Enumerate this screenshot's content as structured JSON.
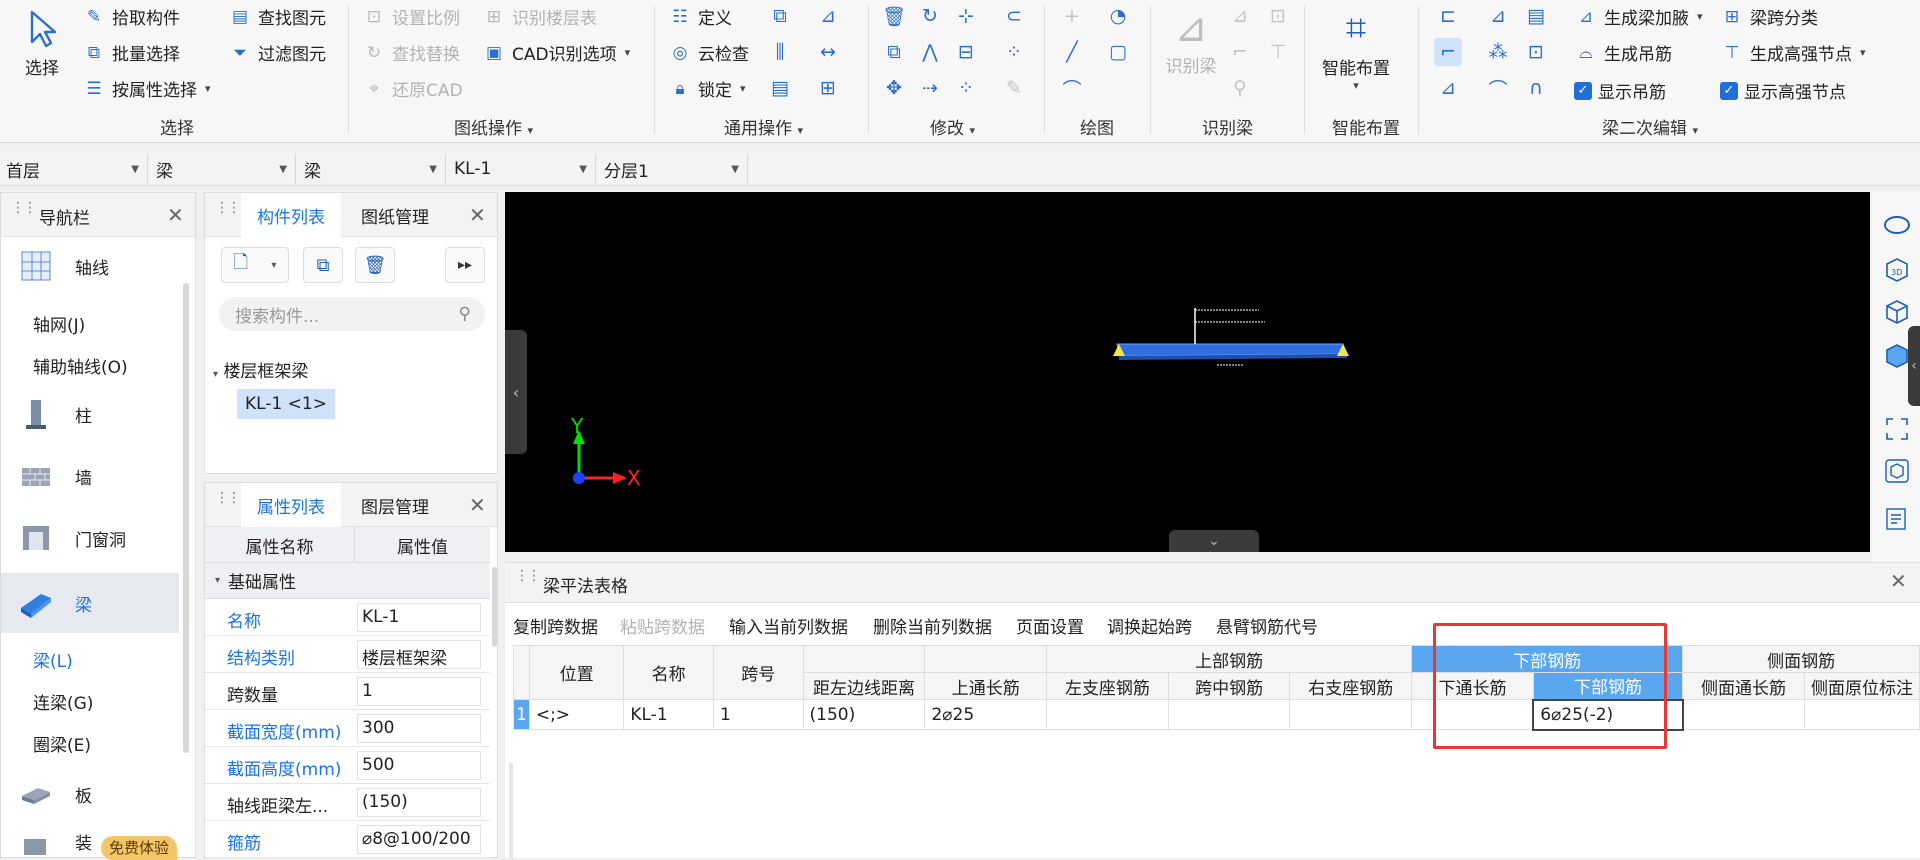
{
  "ribbon": {
    "select_group": {
      "select": "选择",
      "pick": "拾取构件",
      "batch": "批量选择",
      "by_attr": "按属性选择",
      "find": "查找图元",
      "filter": "过滤图元",
      "label": "选择"
    },
    "drawing_ops": {
      "set_scale": "设置比例",
      "identify_floor_table": "识别楼层表",
      "find_replace": "查找替换",
      "cad_options": "CAD识别选项",
      "restore_cad": "还原CAD",
      "label": "图纸操作"
    },
    "general_ops": {
      "define": "定义",
      "cloud_check": "云检查",
      "lock": "锁定",
      "label": "通用操作"
    },
    "modify": {
      "label": "修改"
    },
    "draw": {
      "label": "绘图"
    },
    "identify_beam": {
      "identify": "识别梁",
      "label": "识别梁"
    },
    "smart_layout": {
      "layout": "智能布置",
      "label": "智能布置"
    },
    "beam_secondary": {
      "gen_haunch": "生成梁加腋",
      "span_classify": "梁跨分类",
      "gen_hanger": "生成吊筋",
      "gen_high_node": "生成高强节点",
      "show_hanger": "显示吊筋",
      "show_high_node": "显示高强节点",
      "label": "梁二次编辑"
    }
  },
  "filterbar": [
    "首层",
    "梁",
    "梁",
    "KL-1",
    "分层1"
  ],
  "nav": {
    "title": "导航栏",
    "axis": "轴线",
    "axis_grid": "轴网(J)",
    "aux_axis": "辅助轴线(O)",
    "column": "柱",
    "wall": "墙",
    "door_window": "门窗洞",
    "beam": "梁",
    "beam_l": "梁(L)",
    "coupling_beam": "连梁(G)",
    "ring_beam": "圈梁(E)",
    "slab": "板",
    "free_trial": "免费体验",
    "partial_item": "装"
  },
  "component_list": {
    "tab1": "构件列表",
    "tab2": "图纸管理",
    "search_placeholder": "搜索构件...",
    "tree_parent": "楼层框架梁",
    "tree_child": "KL-1 <1>"
  },
  "properties": {
    "tab1": "属性列表",
    "tab2": "图层管理",
    "col_name": "属性名称",
    "col_value": "属性值",
    "section": "基础属性",
    "rows": [
      {
        "k": "名称",
        "v": "KL-1",
        "blue": true
      },
      {
        "k": "结构类别",
        "v": "楼层框架梁",
        "blue": true
      },
      {
        "k": "跨数量",
        "v": "1",
        "blue": false
      },
      {
        "k": "截面宽度(mm)",
        "v": "300",
        "blue": true
      },
      {
        "k": "截面高度(mm)",
        "v": "500",
        "blue": true
      },
      {
        "k": "轴线距梁左...",
        "v": "(150)",
        "blue": false
      },
      {
        "k": "箍筋",
        "v": "⌀8@100/200",
        "blue": true
      }
    ]
  },
  "viewport": {
    "axis_y": "Y",
    "axis_x": "X"
  },
  "table_panel": {
    "title": "梁平法表格",
    "toolbar": [
      "复制跨数据",
      "粘贴跨数据",
      "输入当前列数据",
      "删除当前列数据",
      "页面设置",
      "调换起始跨",
      "悬臂钢筋代号"
    ],
    "headers_top": {
      "position": "位置",
      "name": "名称",
      "span": "跨号",
      "dist": "距左边线距离",
      "top_through": "上通长筋",
      "top_group": "上部钢筋",
      "bottom_group": "下部钢筋",
      "side_group": "侧面钢筋"
    },
    "headers_sub": {
      "left_support": "左支座钢筋",
      "mid_span": "跨中钢筋",
      "right_support": "右支座钢筋",
      "bottom_through": "下通长筋",
      "bottom_bar": "下部钢筋",
      "side_through": "侧面通长筋",
      "side_original": "侧面原位标注"
    },
    "row": {
      "index": "1",
      "position": "<;>",
      "name": "KL-1",
      "span": "1",
      "dist": "(150)",
      "top_through": "2⌀25",
      "bottom_bar": "6⌀25(-2)"
    }
  },
  "colors": {
    "accent": "#1a73e8",
    "highlight_box": "#e53935",
    "selected_header": "#5aa7f0"
  }
}
